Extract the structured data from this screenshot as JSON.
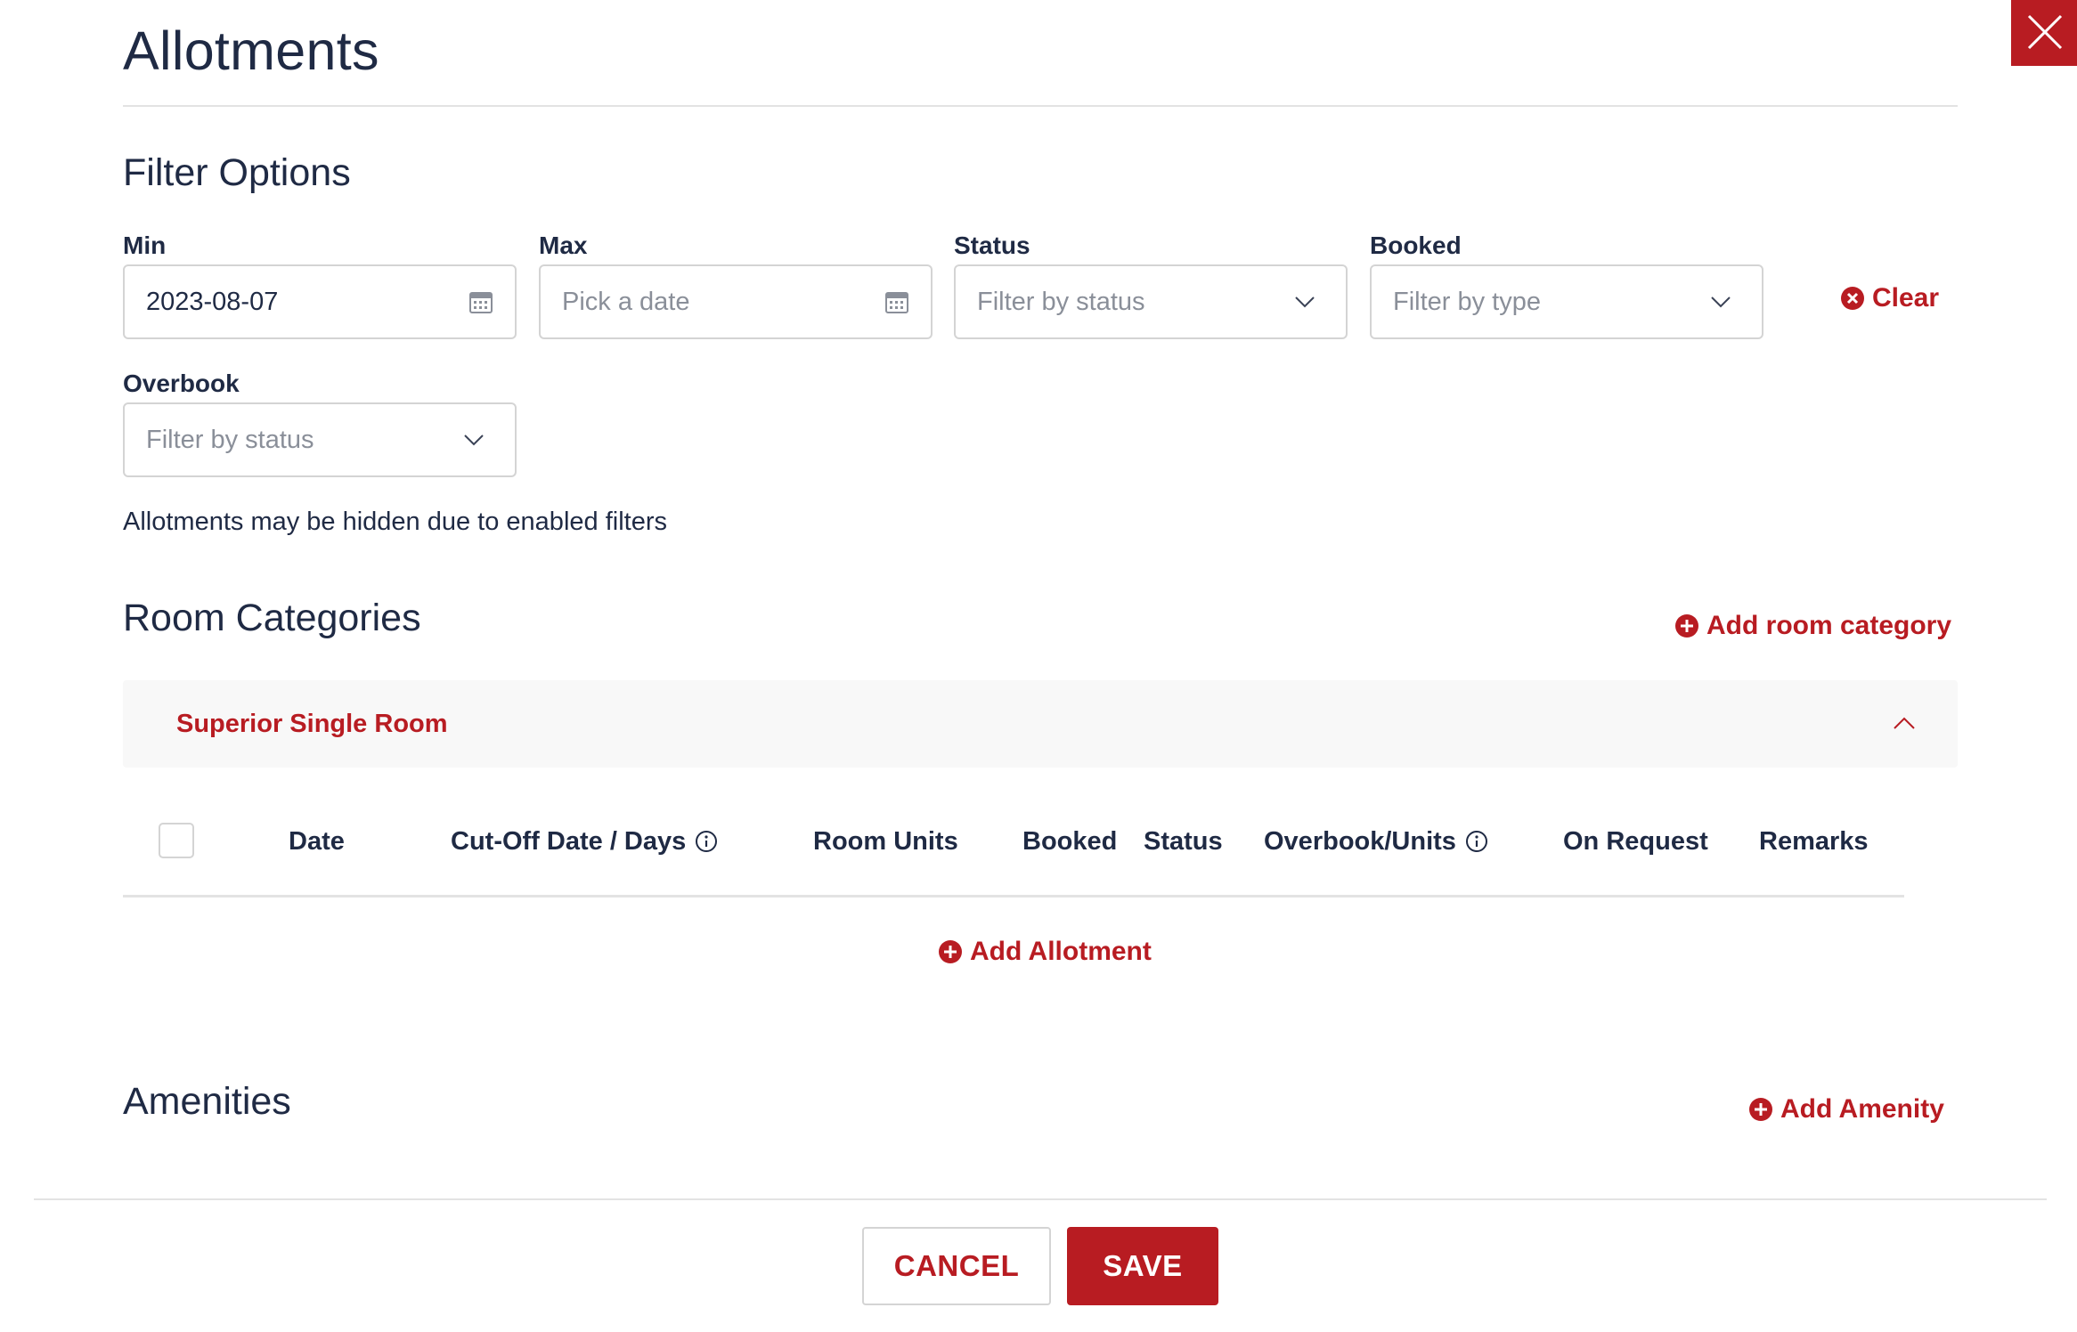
{
  "page": {
    "title": "Allotments"
  },
  "filters": {
    "section_title": "Filter Options",
    "min": {
      "label": "Min",
      "value": "2023-08-07",
      "icon": "calendar-icon"
    },
    "max": {
      "label": "Max",
      "placeholder": "Pick a date",
      "icon": "calendar-icon"
    },
    "status": {
      "label": "Status",
      "placeholder": "Filter by status",
      "icon": "chevron-down-icon"
    },
    "booked": {
      "label": "Booked",
      "placeholder": "Filter by type",
      "icon": "chevron-down-icon"
    },
    "overbook": {
      "label": "Overbook",
      "placeholder": "Filter by status",
      "icon": "chevron-down-icon"
    },
    "clear_label": "Clear",
    "note": "Allotments may be hidden due to enabled filters"
  },
  "room_categories": {
    "section_title": "Room Categories",
    "add_label": "Add room category",
    "categories": [
      {
        "name": "Superior Single Room",
        "expanded": true,
        "columns": [
          "Date",
          "Cut-Off Date / Days",
          "Room Units",
          "Booked",
          "Status",
          "Overbook/Units",
          "On Request",
          "Remarks"
        ],
        "rows": [],
        "add_allotment_label": "Add Allotment"
      }
    ]
  },
  "amenities": {
    "section_title": "Amenities",
    "add_label": "Add Amenity"
  },
  "footer": {
    "cancel_label": "CANCEL",
    "save_label": "SAVE"
  },
  "colors": {
    "accent": "#b81c22",
    "text": "#1f2a44",
    "border": "#d4d4d4",
    "placeholder": "#8a8f99",
    "panel": "#f8f8f8"
  }
}
